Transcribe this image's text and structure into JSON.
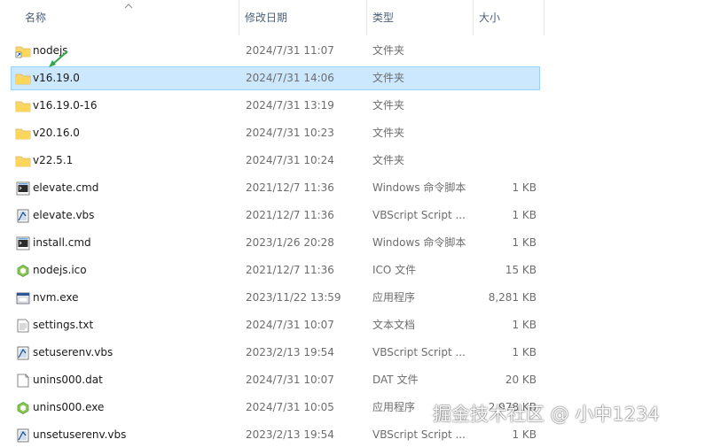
{
  "columns": {
    "name": "名称",
    "date": "修改日期",
    "type": "类型",
    "size": "大小"
  },
  "colors": {
    "selected_bg": "#cce8ff",
    "selected_border": "#99d1ff",
    "folder": "#f8d775",
    "annotation": "#2ea84a"
  },
  "files": [
    {
      "name": "nodejs",
      "date": "2024/7/31 11:07",
      "type": "文件夹",
      "size": "",
      "icon": "folder-shortcut-icon"
    },
    {
      "name": "v16.19.0",
      "date": "2024/7/31 14:06",
      "type": "文件夹",
      "size": "",
      "icon": "folder-icon",
      "selected": true
    },
    {
      "name": "v16.19.0-16",
      "date": "2024/7/31 13:19",
      "type": "文件夹",
      "size": "",
      "icon": "folder-icon"
    },
    {
      "name": "v20.16.0",
      "date": "2024/7/31 10:23",
      "type": "文件夹",
      "size": "",
      "icon": "folder-icon"
    },
    {
      "name": "v22.5.1",
      "date": "2024/7/31 10:24",
      "type": "文件夹",
      "size": "",
      "icon": "folder-icon"
    },
    {
      "name": "elevate.cmd",
      "date": "2021/12/7 11:36",
      "type": "Windows 命令脚本",
      "size": "1 KB",
      "icon": "cmd-file-icon"
    },
    {
      "name": "elevate.vbs",
      "date": "2021/12/7 11:36",
      "type": "VBScript Script ...",
      "size": "1 KB",
      "icon": "vbs-file-icon"
    },
    {
      "name": "install.cmd",
      "date": "2023/1/26 20:28",
      "type": "Windows 命令脚本",
      "size": "1 KB",
      "icon": "cmd-file-icon"
    },
    {
      "name": "nodejs.ico",
      "date": "2021/12/7 11:36",
      "type": "ICO 文件",
      "size": "15 KB",
      "icon": "nodejs-ico-icon"
    },
    {
      "name": "nvm.exe",
      "date": "2023/11/22 13:59",
      "type": "应用程序",
      "size": "8,281 KB",
      "icon": "exe-file-icon"
    },
    {
      "name": "settings.txt",
      "date": "2024/7/31 10:07",
      "type": "文本文档",
      "size": "1 KB",
      "icon": "txt-file-icon"
    },
    {
      "name": "setuserenv.vbs",
      "date": "2023/2/13 19:54",
      "type": "VBScript Script ...",
      "size": "1 KB",
      "icon": "vbs-file-icon"
    },
    {
      "name": "unins000.dat",
      "date": "2024/7/31 10:07",
      "type": "DAT 文件",
      "size": "20 KB",
      "icon": "dat-file-icon"
    },
    {
      "name": "unins000.exe",
      "date": "2024/7/31 10:05",
      "type": "应用程序",
      "size": "2,978 KB",
      "icon": "nodejs-exe-icon"
    },
    {
      "name": "unsetuserenv.vbs",
      "date": "2023/2/13 19:54",
      "type": "VBScript Script ...",
      "size": "1 KB",
      "icon": "vbs-file-icon"
    }
  ],
  "watermark": "掘金技术社区 @ 小中1234"
}
